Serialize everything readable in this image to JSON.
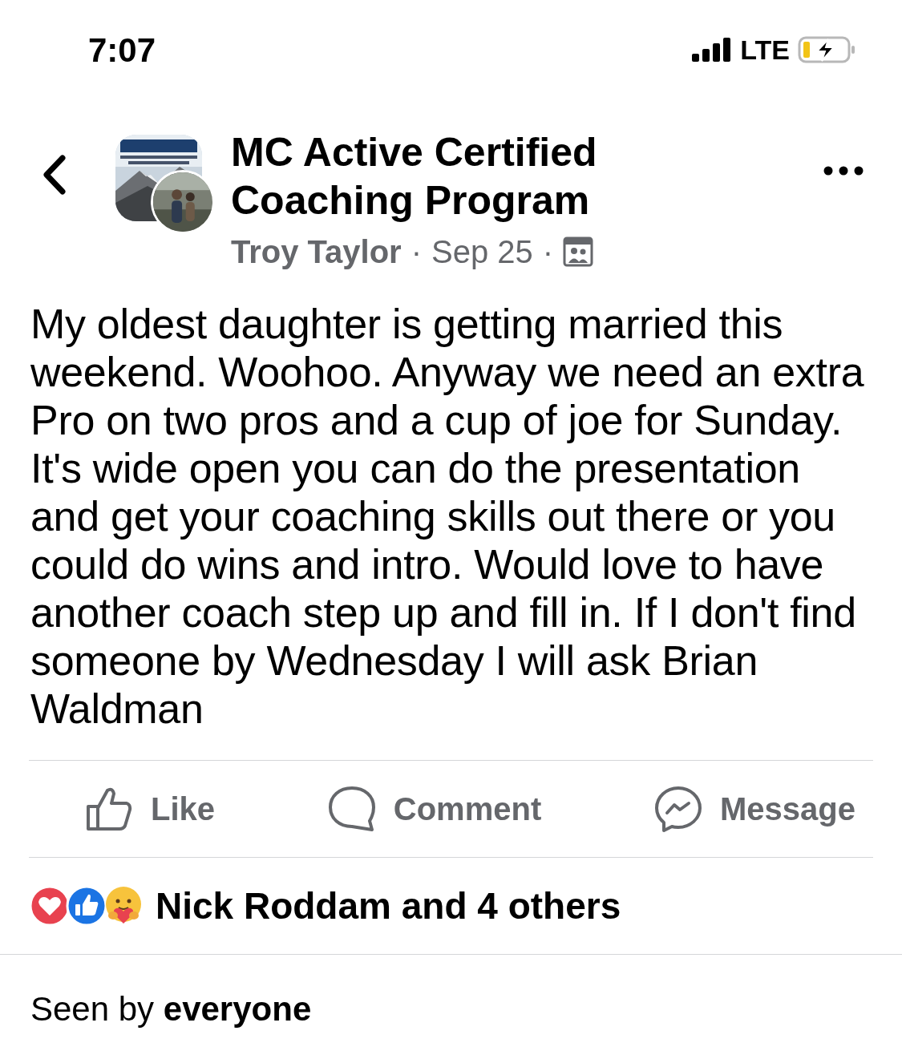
{
  "status_bar": {
    "time": "7:07",
    "network": "LTE"
  },
  "header": {
    "group_name": "MC Active Certified Coaching Program",
    "author": "Troy Taylor",
    "separator_1": "·",
    "date": "Sep 25",
    "separator_2": "·"
  },
  "post": {
    "text": "My oldest daughter is getting married this weekend. Woohoo. Anyway we need an extra Pro on two pros and a cup of joe for Sunday. It's wide open you can do the presentation and get your coaching skills out there or you could do wins and intro. Would love to have another coach step up and fill in. If I don't find someone by Wednesday I will ask Brian Waldman"
  },
  "actions": [
    {
      "kind": "like",
      "label": "Like"
    },
    {
      "kind": "comment",
      "label": "Comment"
    },
    {
      "kind": "message",
      "label": "Message"
    }
  ],
  "reactions": {
    "types": [
      {
        "kind": "love"
      },
      {
        "kind": "like"
      },
      {
        "kind": "care"
      }
    ],
    "summary": "Nick Roddam and 4 others"
  },
  "seen_by": "Seen by **everyone**"
}
